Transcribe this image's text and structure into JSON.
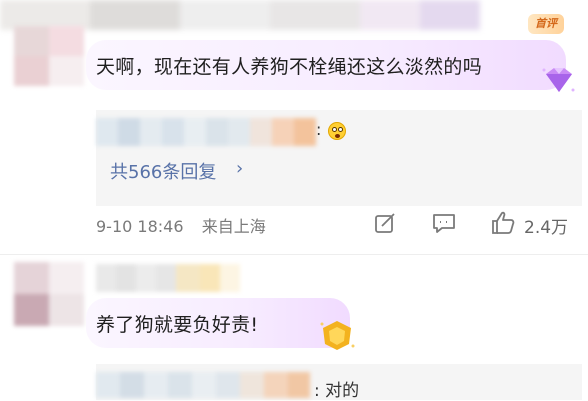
{
  "header": {
    "sort_badge": "首评"
  },
  "comment1": {
    "text": "天啊，现在还有人养狗不栓绳还这么淡然的吗",
    "reply_preview": {
      "separator": ":",
      "emoji": "shocked-face-emoji"
    },
    "more_replies": "共566条回复",
    "more_chevron": "›",
    "timestamp": "9-10 18:46",
    "source": "来自上海",
    "like_count": "2.4万"
  },
  "comment2": {
    "text": "养了狗就要负好责!",
    "reply_preview": {
      "text": ": 对的"
    }
  },
  "colors": {
    "link": "#5872a8",
    "meta": "#7a7a7a",
    "bubble": "#f7ecff",
    "reply_bg": "#f5f5f5",
    "badge_text": "#d4681a"
  }
}
